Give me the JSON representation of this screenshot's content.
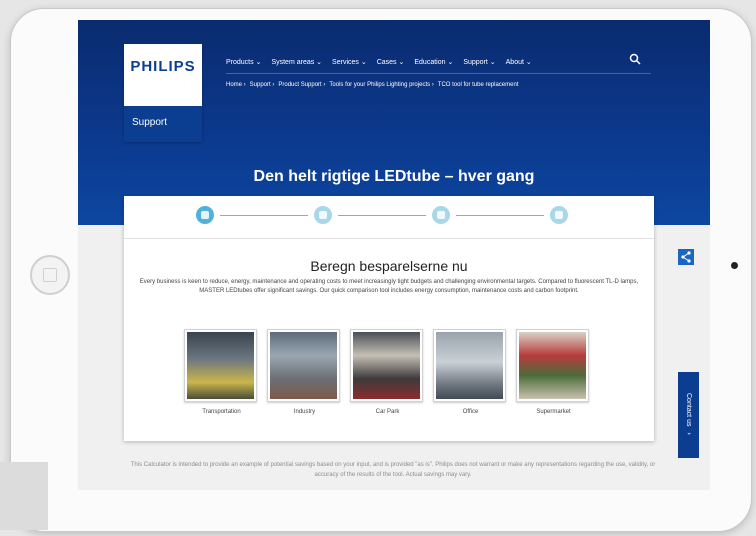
{
  "logo": {
    "brand": "PHILIPS",
    "section": "Support"
  },
  "nav": {
    "items": [
      "Products ⌄",
      "System areas ⌄",
      "Services ⌄",
      "Cases ⌄",
      "Education ⌄",
      "Support ⌄",
      "About ⌄"
    ],
    "search_icon": "search-icon"
  },
  "breadcrumb": [
    "Home ›",
    "Support ›",
    "Product Support ›",
    "Tools for your Philips Lighting projects ›",
    "TCO tool for tube replacement"
  ],
  "hero": {
    "headline": "Den helt rigtige LEDtube – hver gang"
  },
  "stepper": {
    "steps": [
      "step-1-icon",
      "step-2-icon",
      "step-3-icon",
      "step-4-icon"
    ],
    "active": 0
  },
  "card": {
    "title": "Beregn besparelserne nu",
    "description": "Every business is keen to reduce, energy, maintenance and operating costs to meet increasingly tight budgets and challenging environmental targets. Compared to fluorescent TL-D lamps, MASTER LEDtubes offer significant savings. Our quick comparison tool includes energy consumption, maintenance costs and carbon footprint."
  },
  "tiles": [
    {
      "label": "Transportation"
    },
    {
      "label": "Industry"
    },
    {
      "label": "Car Park"
    },
    {
      "label": "Office"
    },
    {
      "label": "Supermarket"
    }
  ],
  "disclaimer": "This Calculator is intended to provide an example of potential savings based on your input, and is provided \"as is\". Philips does not warrant or make any representations regarding the use, validity, or accuracy of the results of the tool. Actual savings may vary.",
  "side": {
    "share_icon": "share-icon",
    "contact_label": "Contact us  ⌄"
  },
  "colors": {
    "brand_blue": "#0b3d91",
    "step_active": "#4fb3d9",
    "step_inactive": "#a8d7e9"
  }
}
